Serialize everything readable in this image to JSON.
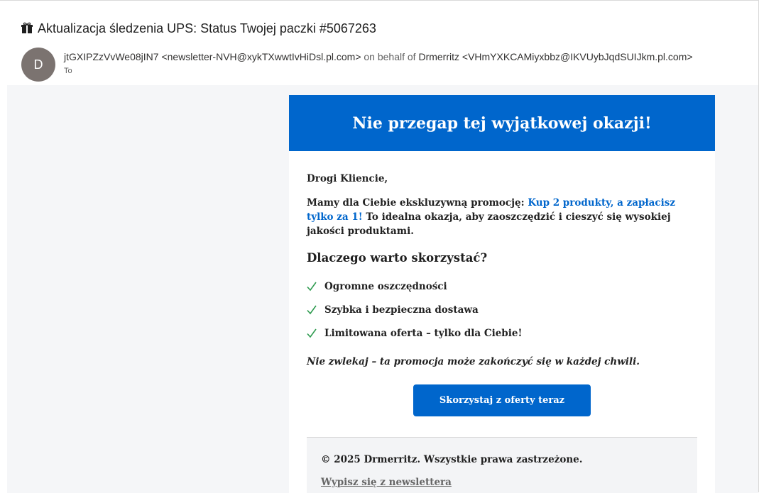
{
  "email": {
    "subject": "Aktualizacja śledzenia UPS: Status Twojej paczki #5067263",
    "subject_icon": "gift-icon",
    "avatar_initial": "D",
    "sender_name": "jtGXIPZzVvWe08jIN7",
    "sender_address": "<newsletter-NVH@xykTXwwtIvHiDsl.pl.com>",
    "on_behalf_text": "on behalf of",
    "behalf_name": "Drmerritz",
    "behalf_address": "<VHmYXKCAMiyxbbz@IKVUybJqdSUIJkm.pl.com>",
    "to_label": "To"
  },
  "message": {
    "banner_title": "Nie przegap tej wyjątkowej okazji!",
    "greeting": "Drogi Kliencie,",
    "promo_intro": "Mamy dla Ciebie ekskluzywną promocję: ",
    "promo_highlight": "Kup 2 produkty, a zapłacisz tylko za 1!",
    "promo_rest": " To idealna okazja, aby zaoszczędzić i cieszyć się wysokiej jakości produktami.",
    "why_heading": "Dlaczego warto skorzystać?",
    "benefits": [
      "Ogromne oszczędności",
      "Szybka i bezpieczna dostawa",
      "Limitowana oferta – tylko dla Ciebie!"
    ],
    "urgency": "Nie zwlekaj – ta promocja może zakończyć się w każdej chwili.",
    "cta_label": "Skorzystaj z oferty teraz",
    "copyright": "© 2025 Drmerritz. Wszystkie prawa zastrzeżone.",
    "unsubscribe": "Wypisz się z newslettera"
  },
  "colors": {
    "brand_blue": "#0066cc",
    "check_green": "#2e9b4f",
    "avatar_gray": "#7b7370"
  }
}
